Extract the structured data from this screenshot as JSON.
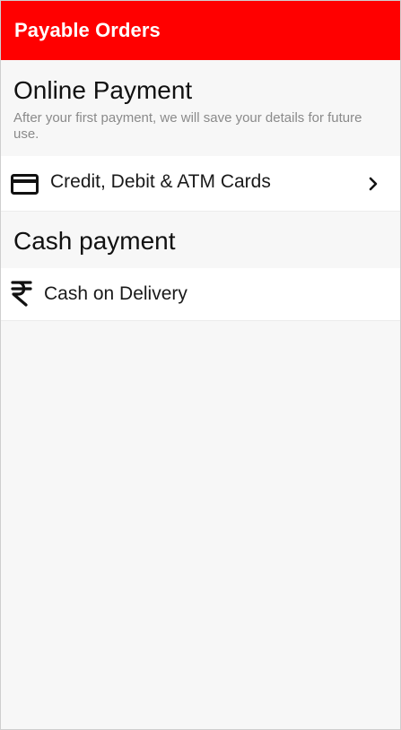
{
  "app_bar": {
    "title": "Payable Orders",
    "color": "#ff0000"
  },
  "online_payment": {
    "title": "Online Payment",
    "subtitle": "After your first payment, we will save your details for future use.",
    "options": [
      {
        "label": "Credit, Debit & ATM Cards",
        "icon": "credit-card-icon",
        "trailing_icon": "chevron-right-icon"
      }
    ]
  },
  "cash_payment": {
    "title": "Cash payment",
    "options": [
      {
        "label": "Cash on Delivery",
        "icon": "rupee-icon"
      }
    ]
  }
}
